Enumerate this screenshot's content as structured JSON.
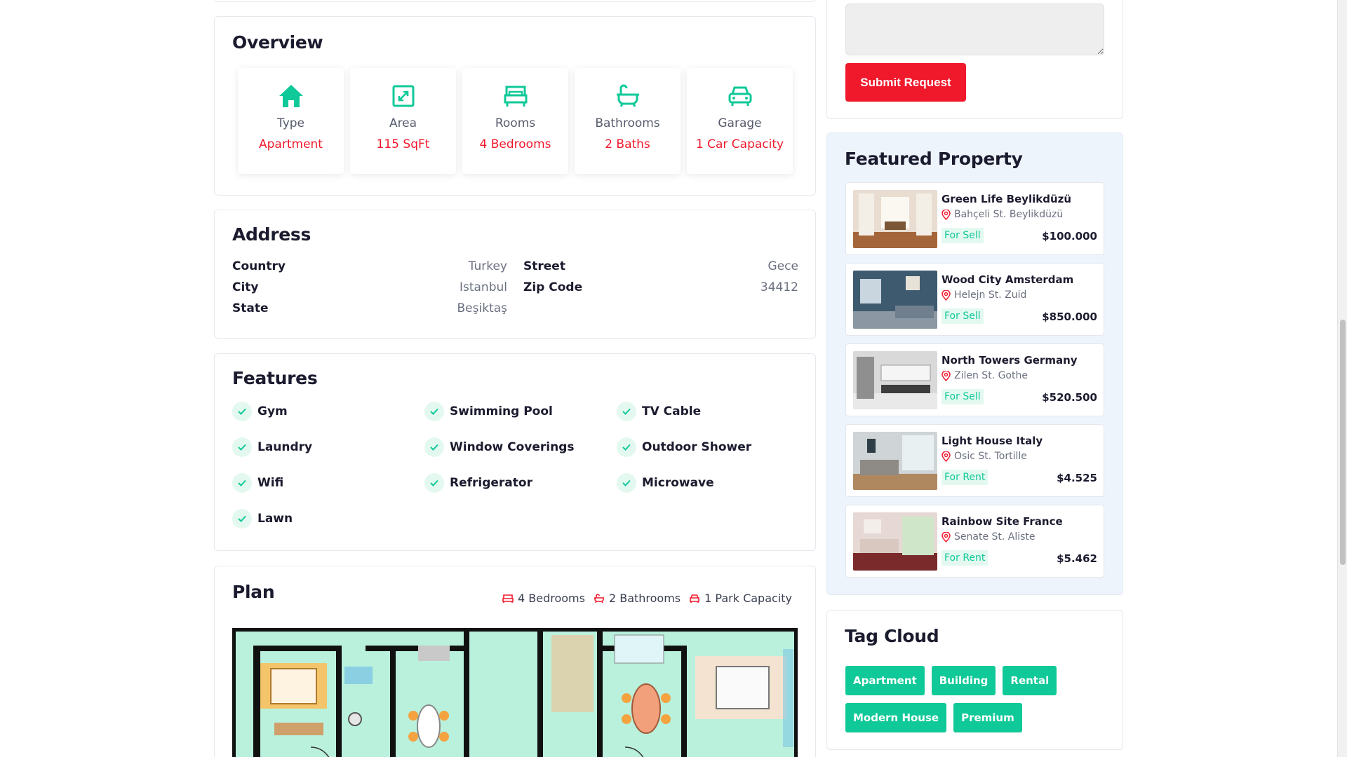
{
  "overview": {
    "title": "Overview",
    "items": [
      {
        "label": "Type",
        "value": "Apartment",
        "icon": "home-icon"
      },
      {
        "label": "Area",
        "value": "115 SqFt",
        "icon": "area-icon"
      },
      {
        "label": "Rooms",
        "value": "4 Bedrooms",
        "icon": "bed-icon"
      },
      {
        "label": "Bathrooms",
        "value": "2 Baths",
        "icon": "bath-icon"
      },
      {
        "label": "Garage",
        "value": "1 Car Capacity",
        "icon": "car-icon"
      }
    ]
  },
  "address": {
    "title": "Address",
    "left": [
      {
        "key": "Country",
        "value": "Turkey"
      },
      {
        "key": "City",
        "value": "Istanbul"
      },
      {
        "key": "State",
        "value": "Beşiktaş"
      }
    ],
    "right": [
      {
        "key": "Street",
        "value": "Gece"
      },
      {
        "key": "Zip Code",
        "value": "34412"
      }
    ]
  },
  "features": {
    "title": "Features",
    "items": [
      "Gym",
      "Swimming Pool",
      "TV Cable",
      "Laundry",
      "Window Coverings",
      "Outdoor Shower",
      "Wifi",
      "Refrigerator",
      "Microwave",
      "Lawn"
    ]
  },
  "plan": {
    "title": "Plan",
    "bedrooms": "4 Bedrooms",
    "bathrooms": "2 Bathrooms",
    "parking": "1 Park Capacity"
  },
  "request": {
    "message_value": "",
    "submit_label": "Submit Request"
  },
  "featured": {
    "title": "Featured Property",
    "items": [
      {
        "name": "Green Life Beylikdüzü",
        "location": "Bahçeli St. Beylikdüzü",
        "status": "For Sell",
        "price": "$100.000"
      },
      {
        "name": "Wood City Amsterdam",
        "location": "Helejn St. Zuid",
        "status": "For Sell",
        "price": "$850.000"
      },
      {
        "name": "North Towers Germany",
        "location": "Zilen St. Gothe",
        "status": "For Sell",
        "price": "$520.500"
      },
      {
        "name": "Light House Italy",
        "location": "Osic St. Tortille",
        "status": "For Rent",
        "price": "$4.525"
      },
      {
        "name": "Rainbow Site France",
        "location": "Senate St. Aliste",
        "status": "For Rent",
        "price": "$5.462"
      }
    ]
  },
  "tag_cloud": {
    "title": "Tag Cloud",
    "tags": [
      "Apartment",
      "Building",
      "Rental",
      "Modern House",
      "Premium"
    ]
  },
  "colors": {
    "accent_green": "#10c998",
    "accent_red": "#f0192c",
    "heading": "#1b1b2f"
  }
}
